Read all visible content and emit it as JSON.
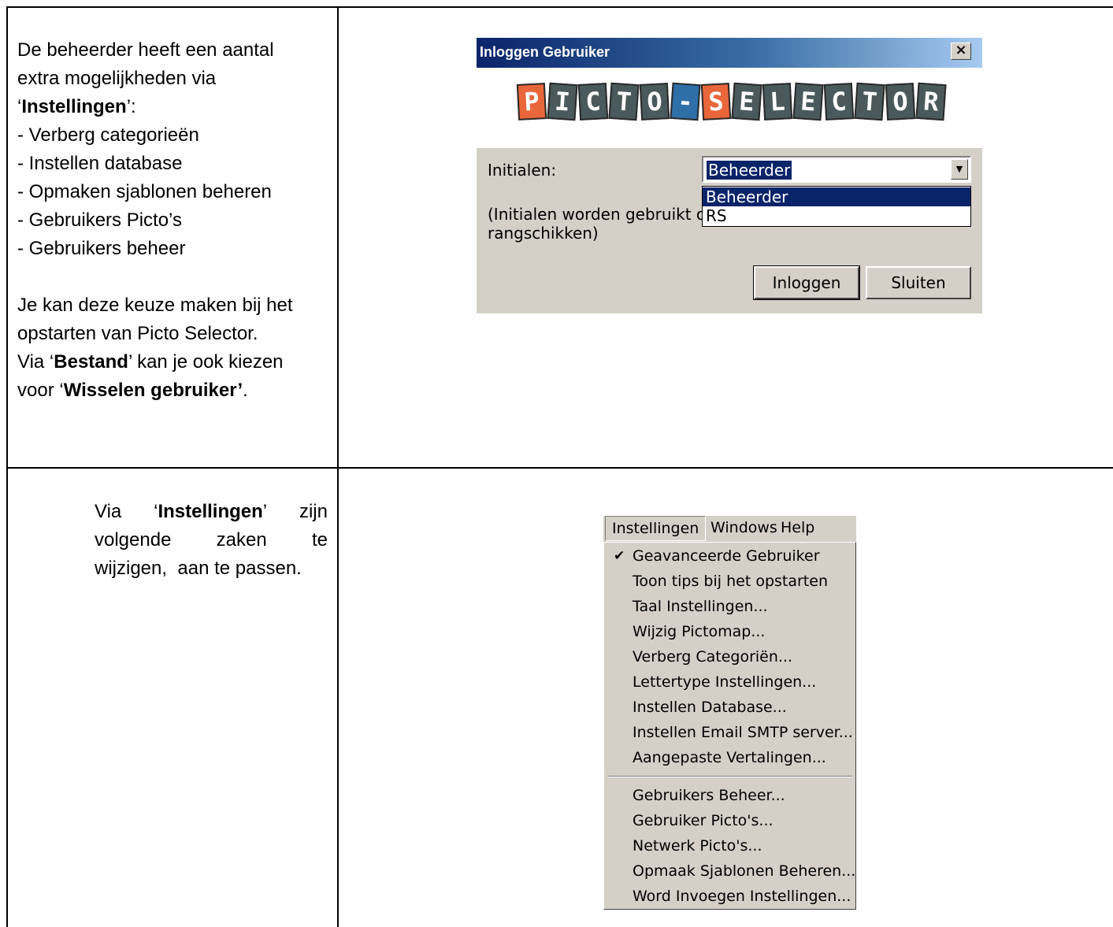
{
  "text1": {
    "l1": "De beheerder heeft een aantal",
    "l2": "extra mogelijkheden via",
    "l3a": "‘",
    "l3b": "Instellingen",
    "l3c": "’:",
    "items": [
      "- Verberg categorieën",
      "- Instellen database",
      "- Opmaken sjablonen beheren",
      "- Gebruikers Picto’s",
      "- Gebruikers beheer"
    ],
    "p2l1": "Je kan deze keuze maken bij het",
    "p2l2": "opstarten van Picto Selector.",
    "p2l3a": "Via ‘",
    "p2l3b": "Bestand",
    "p2l3c": "’ kan je ook kiezen",
    "p2l4a": "voor ‘",
    "p2l4b": "Wisselen gebruiker’",
    "p2l4c": "."
  },
  "text2": {
    "w1": "Via",
    "w2a": "‘",
    "w2b": "Instellingen",
    "w2c": "’",
    "w3": "zijn",
    "l2": [
      "volgende",
      "zaken",
      "te"
    ],
    "l3": "wijzigen,  aan te passen."
  },
  "dialog": {
    "title": "Inloggen Gebruiker",
    "close": "×",
    "logo_letters": [
      "P",
      "I",
      "C",
      "T",
      "O",
      "-",
      "S",
      "E",
      "L",
      "E",
      "C",
      "T",
      "O",
      "R"
    ],
    "initials_label": "Initialen:",
    "combo_value": "Beheerder",
    "options": [
      "Beheerder",
      "RS"
    ],
    "hint_line1": "(Initialen worden gebruikt o",
    "hint_line2": "rangschikken)",
    "login_button": "Inloggen",
    "close_button": "Sluiten"
  },
  "menu": {
    "menubar": [
      "Instellingen",
      "Windows",
      "Help"
    ],
    "items_group1": [
      "Geavanceerde Gebruiker",
      "Toon tips bij het opstarten",
      "Taal Instellingen...",
      "Wijzig Pictomap...",
      "Verberg Categoriën...",
      "Lettertype Instellingen...",
      "Instellen Database...",
      "Instellen Email SMTP server...",
      "Aangepaste Vertalingen..."
    ],
    "items_group2": [
      "Gebruikers Beheer...",
      "Gebruiker Picto's...",
      "Netwerk Picto's...",
      "Opmaak Sjablonen Beheren...",
      "Word Invoegen Instellingen..."
    ],
    "checked": "✔"
  }
}
